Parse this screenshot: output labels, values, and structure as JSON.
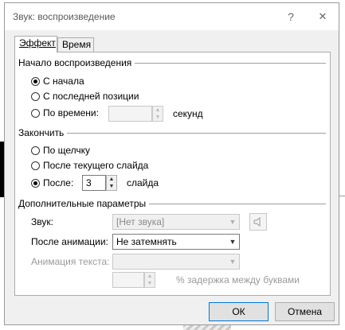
{
  "window": {
    "title": "Звук: воспроизведение",
    "help": "?",
    "close": "✕"
  },
  "tabs": [
    {
      "label": "Эффект",
      "active": true
    },
    {
      "label": "Время",
      "active": false
    }
  ],
  "start_group": {
    "title": "Начало воспроизведения",
    "options": [
      {
        "label": "С начала",
        "checked": true
      },
      {
        "label": "С последней позиции",
        "checked": false
      },
      {
        "label": "По времени:",
        "checked": false
      }
    ],
    "time_value": "",
    "seconds_label": "секунд"
  },
  "stop_group": {
    "title": "Закончить",
    "options": [
      {
        "label": "По щелчку",
        "checked": false
      },
      {
        "label": "После текущего слайда",
        "checked": false
      },
      {
        "label": "После:",
        "checked": true
      }
    ],
    "after_value": "3",
    "slides_label": "слайда"
  },
  "extra_group": {
    "title": "Дополнительные параметры",
    "sound_label": "Звук:",
    "sound_value": "[Нет звука]",
    "after_anim_label": "После анимации:",
    "after_anim_value": "Не затемнять",
    "text_anim_label": "Анимация текста:",
    "text_anim_value": "",
    "delay_value": "",
    "delay_label": "% задержка между буквами"
  },
  "buttons": {
    "ok": "ОК",
    "cancel": "Отмена"
  }
}
